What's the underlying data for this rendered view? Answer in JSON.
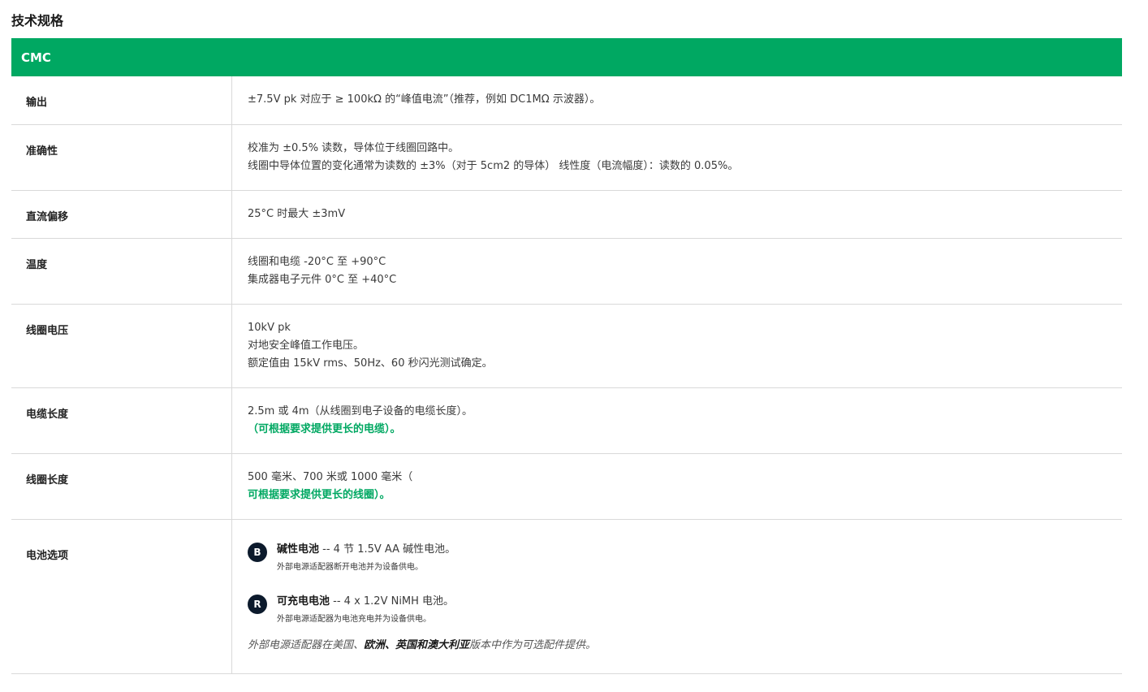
{
  "page_title": "技术规格",
  "table_header": "CMC",
  "rows": [
    {
      "label": "输出",
      "lines": [
        "±7.5V pk 对应于 ≥ 100kΩ 的“峰值电流”（推荐，例如 DC1MΩ 示波器）。"
      ]
    },
    {
      "label": "准确性",
      "lines": [
        "校准为 ±0.5% 读数，导体位于线圈回路中。",
        "线圈中导体位置的变化通常为读数的 ±3%（对于 5cm2 的导体） 线性度（电流幅度）：读数的 0.05%。"
      ]
    },
    {
      "label": "直流偏移",
      "lines": [
        "25°C 时最大 ±3mV"
      ]
    },
    {
      "label": "温度",
      "lines": [
        "线圈和电缆 -20°C 至 +90°C",
        "集成器电子元件 0°C 至 +40°C"
      ]
    },
    {
      "label": "线圈电压",
      "lines": [
        "10kV pk",
        "对地安全峰值工作电压。",
        "额定值由 15kV rms、50Hz、60 秒闪光测试确定。"
      ]
    },
    {
      "label": "电缆长度",
      "lines": [
        "2.5m 或 4m（从线圈到电子设备的电缆长度）。"
      ],
      "highlight": "（可根据要求提供更长的电缆）。"
    },
    {
      "label": "线圈长度",
      "lines": [
        "500 毫米、700 米或 1000 毫米（"
      ],
      "highlight": "可根据要求提供更长的线圈）。"
    },
    {
      "label": "电池选项",
      "battery": [
        {
          "badge": "B",
          "title": "碱性电池",
          "detail": " -- 4 节 1.5V AA 碱性电池。",
          "note": "外部电源适配器断开电池并为设备供电。"
        },
        {
          "badge": "R",
          "title": "可充电电池",
          "detail": " -- 4 x 1.2V NiMH 电池。",
          "note": "外部电源适配器为电池充电并为设备供电。"
        }
      ],
      "footnote": {
        "prefix": "外部电源适配器在美国、",
        "regions": "欧洲、英国和澳大利亚",
        "suffix": "版本中作为可选配件提供。"
      }
    }
  ],
  "colors": {
    "accent": "#00a862",
    "badge_bg": "#0c1a2c"
  }
}
